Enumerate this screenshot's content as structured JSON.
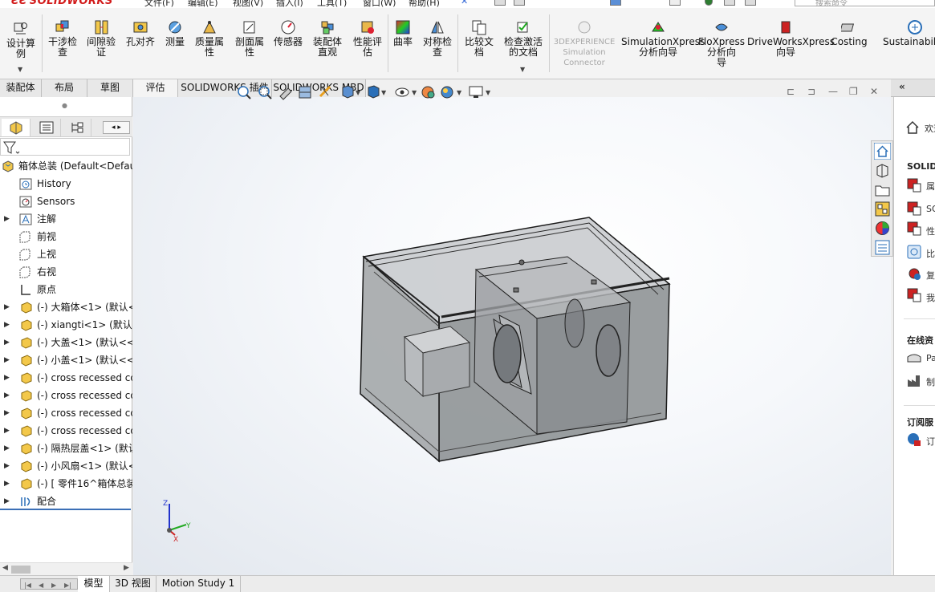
{
  "titlebar": {
    "app_name": "SOLIDWORKS",
    "menu": [
      "文件(F)",
      "编辑(E)",
      "视图(V)",
      "插入(I)",
      "工具(T)",
      "窗口(W)",
      "帮助(H)"
    ],
    "search_placeholder": "搜索命令"
  },
  "ribbon": {
    "design_study": "设计算\n例",
    "interference": "干涉检\n查",
    "clearance": "间隙验\n证",
    "hole_align": "孔对齐",
    "measure": "测量",
    "mass_props": "质量属\n性",
    "section_props": "剖面属\n性",
    "sensor": "传感器",
    "assembly_visual": "装配体\n直观",
    "performance": "性能评\n估",
    "curvature": "曲率",
    "symmetry": "对称检\n查",
    "compare_docs": "比较文\n档",
    "check_active": "检查激活\n的文档",
    "experience": "3DEXPERIENCE\nSimulation\nConnector",
    "simxpress": "SimulationXpress\n分析向导",
    "floxpress": "FloXpress\n分析向\n导",
    "driveworks": "DriveWorksXpress\n向导",
    "costing": "Costing",
    "sustainability": "Sustainabili"
  },
  "cmd_tabs": [
    "装配体",
    "布局",
    "草图",
    "评估",
    "SOLIDWORKS 插件",
    "SOLIDWORKS MBD"
  ],
  "tree": {
    "root": "箱体总装  (Default<Default",
    "items": [
      {
        "label": "History"
      },
      {
        "label": "Sensors"
      },
      {
        "label": "注解"
      },
      {
        "label": "前视"
      },
      {
        "label": "上视"
      },
      {
        "label": "右视"
      },
      {
        "label": "原点"
      },
      {
        "label": "(-) 大箱体<1> (默认<<"
      },
      {
        "label": "(-) xiangti<1> (默认<"
      },
      {
        "label": "(-) 大盖<1> (默认<<"
      },
      {
        "label": "(-) 小盖<1> (默认<<"
      },
      {
        "label": "(-) cross recessed co"
      },
      {
        "label": "(-) cross recessed co"
      },
      {
        "label": "(-) cross recessed co"
      },
      {
        "label": "(-) cross recessed co"
      },
      {
        "label": "(-) 隔热层盖<1> (默认"
      },
      {
        "label": "(-) 小风扇<1> (默认<"
      },
      {
        "label": "(-) [ 零件16^箱体总装"
      },
      {
        "label": "配合"
      }
    ]
  },
  "taskpane": {
    "welcome": "欢迎",
    "solidworks_head": "SOLIDW",
    "items1": [
      "属",
      "SO",
      "性",
      "比",
      "复",
      "我"
    ],
    "online_head": "在线资",
    "items2": [
      "Pa",
      "制"
    ],
    "subscription_head": "订阅服",
    "items3": [
      "订"
    ]
  },
  "bottom_tabs": [
    "模型",
    "3D 视图",
    "Motion Study 1"
  ],
  "triad": {
    "x": "X",
    "y": "Y",
    "z": "Z"
  }
}
